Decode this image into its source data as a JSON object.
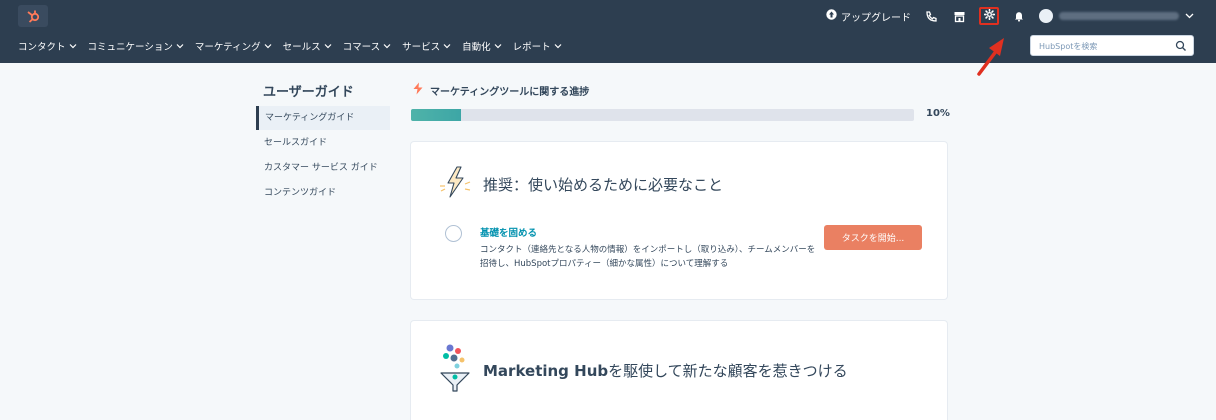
{
  "topbar": {
    "upgrade_label": "アップグレード",
    "search_placeholder": "HubSpotを検索",
    "nav": [
      {
        "label": "コンタクト"
      },
      {
        "label": "コミュニケーション"
      },
      {
        "label": "マーケティング"
      },
      {
        "label": "セールス"
      },
      {
        "label": "コマース"
      },
      {
        "label": "サービス"
      },
      {
        "label": "自動化"
      },
      {
        "label": "レポート"
      }
    ]
  },
  "sidebar": {
    "title": "ユーザーガイド",
    "items": [
      {
        "label": "マーケティングガイド",
        "active": true
      },
      {
        "label": "セールスガイド"
      },
      {
        "label": "カスタマー サービス ガイド"
      },
      {
        "label": "コンテンツガイド"
      }
    ]
  },
  "progress": {
    "title": "マーケティングツールに関する進捗",
    "percent_label": "10%",
    "value": 0.1
  },
  "card1": {
    "heading": "推奨：使い始めるために必要なこと",
    "task": {
      "title": "基礎を固める",
      "description": "コンタクト（連絡先となる人物の情報）をインポートし（取り込み）、チームメンバーを招待し、HubSpotプロパティー（細かな属性）について理解する",
      "button_label": "タスクを開始..."
    }
  },
  "card2": {
    "heading_brand": "Marketing Hub",
    "heading_rest": "を駆使して新たな顧客を惹きつける"
  },
  "colors": {
    "topbar_bg": "#2d3e50",
    "accent_orange": "#ea8062",
    "link_teal": "#0091ae",
    "progress_fill": "#4fb3a9",
    "annotation_red": "#e03020"
  },
  "icons": [
    "hubspot-logo-icon",
    "upgrade-icon",
    "phone-icon",
    "marketplace-icon",
    "gear-icon",
    "bell-icon",
    "search-icon",
    "spark-icon",
    "lightning-icon",
    "funnel-icon"
  ]
}
